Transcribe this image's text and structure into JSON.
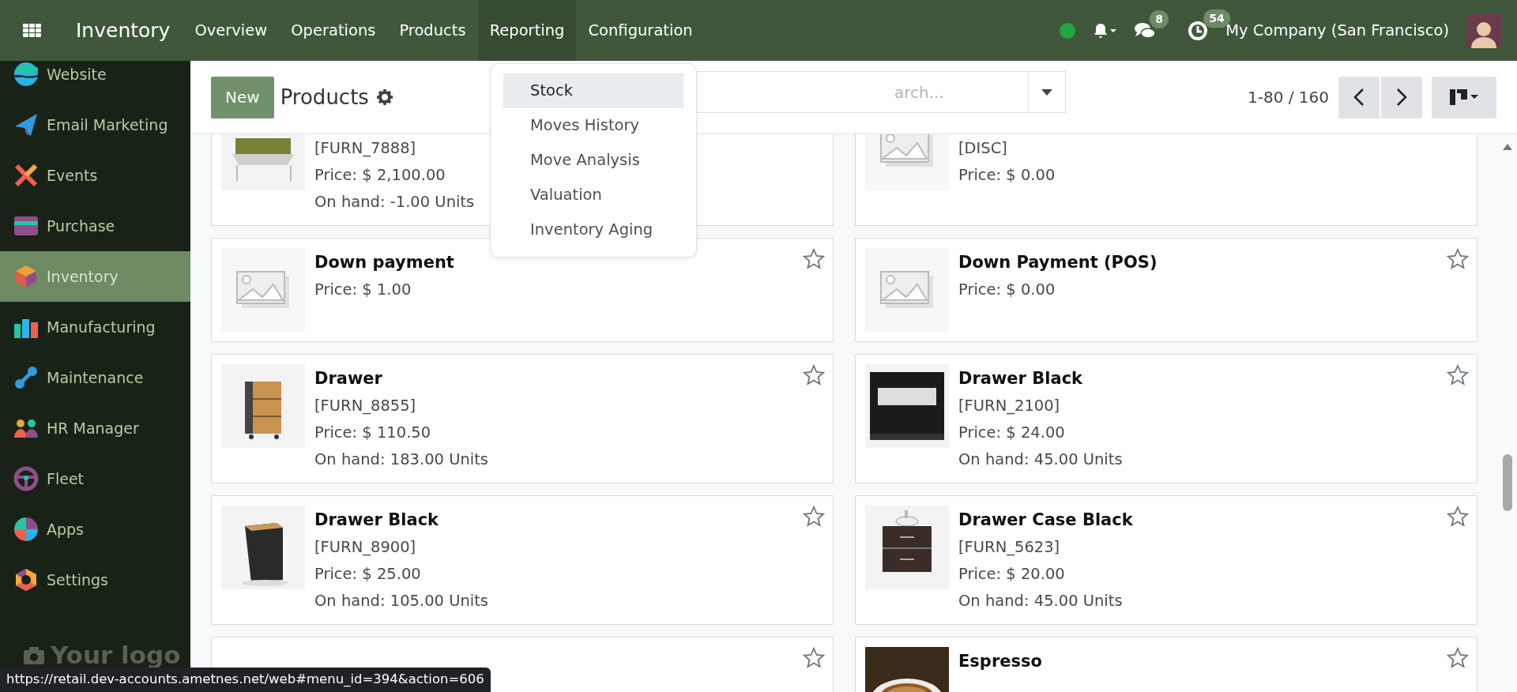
{
  "app": {
    "name": "Inventory"
  },
  "menu": [
    {
      "label": "Overview",
      "open": false
    },
    {
      "label": "Operations",
      "open": false
    },
    {
      "label": "Products",
      "open": false
    },
    {
      "label": "Reporting",
      "open": true
    },
    {
      "label": "Configuration",
      "open": false
    }
  ],
  "reporting_menu": [
    {
      "label": "Stock",
      "selected": true
    },
    {
      "label": "Moves History",
      "selected": false
    },
    {
      "label": "Move Analysis",
      "selected": false
    },
    {
      "label": "Valuation",
      "selected": false
    },
    {
      "label": "Inventory Aging",
      "selected": false
    }
  ],
  "systray": {
    "online": true,
    "messages_count": "8",
    "activities_count": "54",
    "company": "My Company (San Francisco)"
  },
  "sidebar": {
    "items": [
      {
        "label": "Website",
        "selected": false
      },
      {
        "label": "Email Marketing",
        "selected": false
      },
      {
        "label": "Events",
        "selected": false
      },
      {
        "label": "Purchase",
        "selected": false
      },
      {
        "label": "Inventory",
        "selected": true
      },
      {
        "label": "Manufacturing",
        "selected": false
      },
      {
        "label": "Maintenance",
        "selected": false
      },
      {
        "label": "HR Manager",
        "selected": false
      },
      {
        "label": "Fleet",
        "selected": false
      },
      {
        "label": "Apps",
        "selected": false
      },
      {
        "label": "Settings",
        "selected": false
      }
    ],
    "logo_text": "Your logo"
  },
  "control_panel": {
    "new_button": "New",
    "title": "Products",
    "search_placeholder": "arch...",
    "pager": "1-80 / 160"
  },
  "products": [
    {
      "code": "[FURN_7888]",
      "price": "Price: $ 2,100.00",
      "on_hand": "On hand: -1.00 Units"
    },
    {
      "code": "[DISC]",
      "price": "Price: $ 0.00",
      "kind": "placeholder"
    },
    {
      "name": "Down payment",
      "price": "Price: $ 1.00",
      "kind": "placeholder",
      "starred": false
    },
    {
      "name": "Down Payment (POS)",
      "price": "Price: $ 0.00",
      "kind": "placeholder",
      "starred": false
    },
    {
      "name": "Drawer",
      "code": "[FURN_8855]",
      "price": "Price: $ 110.50",
      "on_hand": "On hand: 183.00 Units",
      "starred": false
    },
    {
      "name": "Drawer Black",
      "code": "[FURN_2100]",
      "price": "Price: $ 24.00",
      "on_hand": "On hand: 45.00 Units",
      "starred": false
    },
    {
      "name": "Drawer Black",
      "code": "[FURN_8900]",
      "price": "Price: $ 25.00",
      "on_hand": "On hand: 105.00 Units",
      "starred": false
    },
    {
      "name": "Drawer Case Black",
      "code": "[FURN_5623]",
      "price": "Price: $ 20.00",
      "on_hand": "On hand: 45.00 Units",
      "starred": false
    },
    {
      "starred": false
    },
    {
      "name": "Espresso",
      "starred": false
    }
  ],
  "status_url": "https://retail.dev-accounts.ametnes.net/web#menu_id=394&action=606"
}
